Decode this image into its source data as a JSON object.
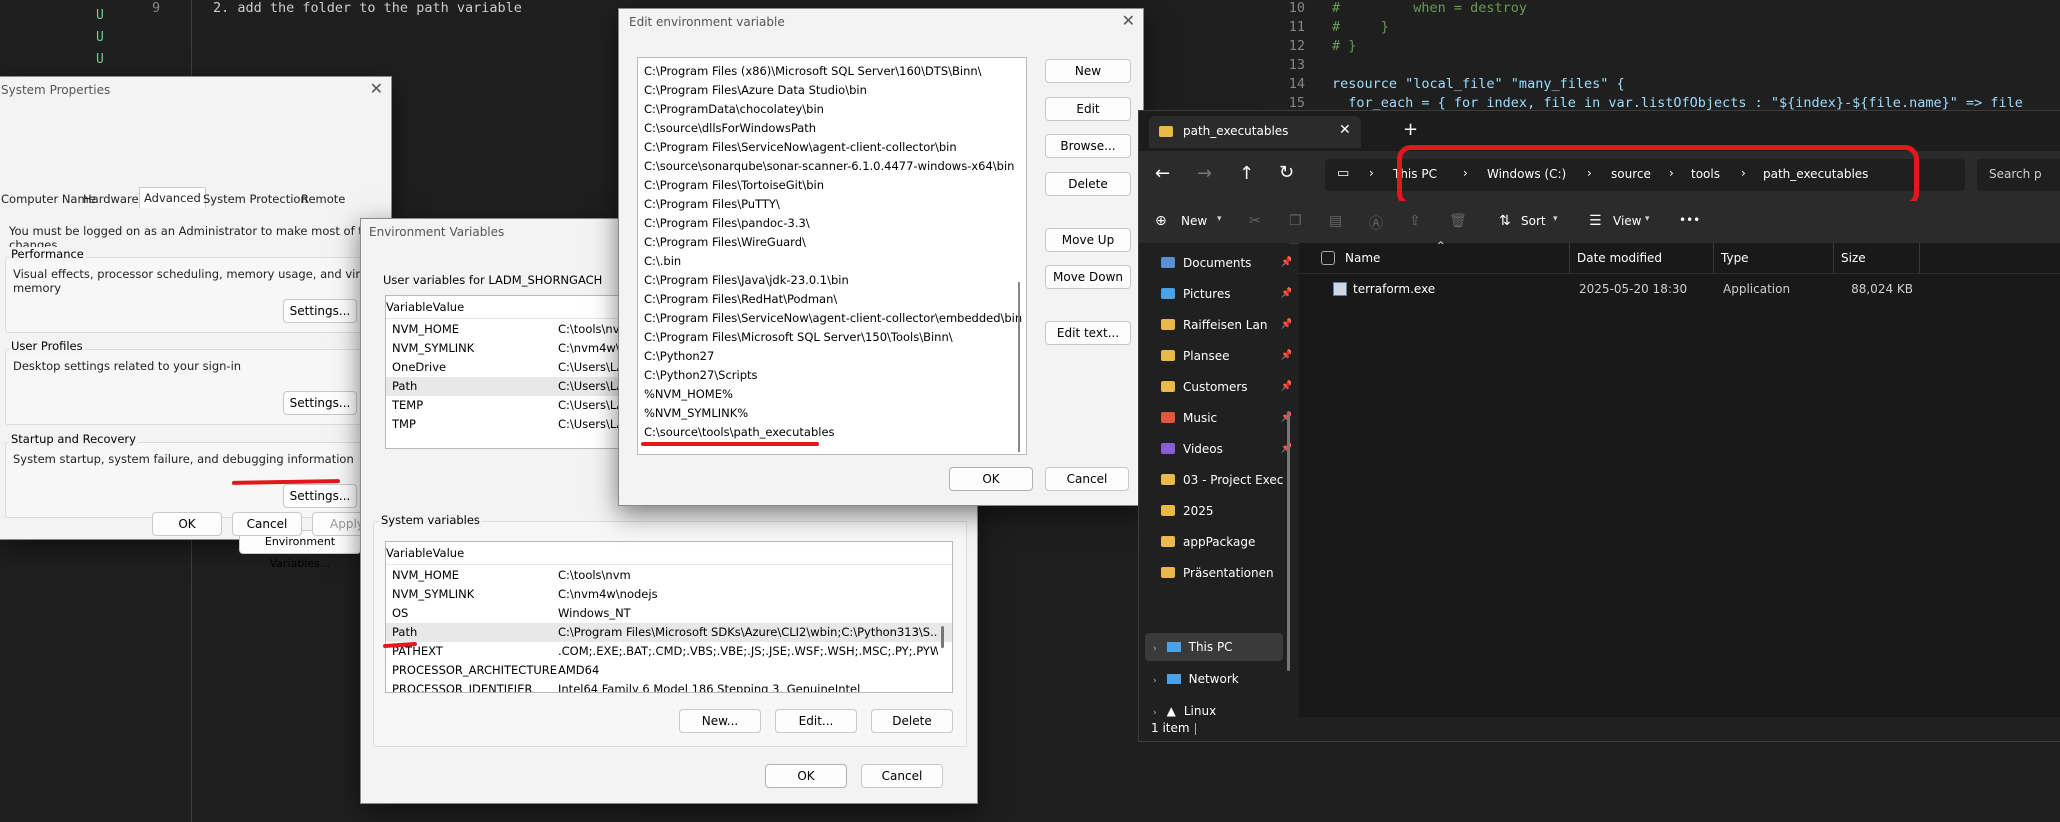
{
  "editor_left": {
    "git_markers": [
      "U",
      "U",
      "U"
    ],
    "line_number": "9",
    "line_text": "2. add the folder to the path variable"
  },
  "editor_right": {
    "lines": [
      {
        "n": "10",
        "text": "#         when = destroy"
      },
      {
        "n": "11",
        "text": "#     }"
      },
      {
        "n": "12",
        "text": "# }"
      },
      {
        "n": "13",
        "text": ""
      },
      {
        "n": "14",
        "text": "resource \"local_file\" \"many_files\" {"
      },
      {
        "n": "15",
        "text": "  for_each = { for index, file in var.listOfObjects : \"${index}-${file.name}\" => file"
      }
    ]
  },
  "system_properties": {
    "title": "System Properties",
    "tabs": [
      "Computer Name",
      "Hardware",
      "Advanced",
      "System Protection",
      "Remote"
    ],
    "admin_note": "You must be logged on as an Administrator to make most of these changes.",
    "performance": {
      "label": "Performance",
      "desc": "Visual effects, processor scheduling, memory usage, and virtual memory",
      "button": "Settings..."
    },
    "user_profiles": {
      "label": "User Profiles",
      "desc": "Desktop settings related to your sign-in",
      "button": "Settings..."
    },
    "startup": {
      "label": "Startup and Recovery",
      "desc": "System startup, system failure, and debugging information",
      "button": "Settings..."
    },
    "env_button": "Environment Variables...",
    "ok": "OK",
    "cancel": "Cancel",
    "apply": "Apply"
  },
  "env_vars": {
    "title": "Environment Variables",
    "user_label": "User variables for LADM_SHORNGACH",
    "col_variable": "Variable",
    "col_value": "Value",
    "user_rows": [
      {
        "name": "NVM_HOME",
        "value": "C:\\tools\\nvm"
      },
      {
        "name": "NVM_SYMLINK",
        "value": "C:\\nvm4w\\nodejs"
      },
      {
        "name": "OneDrive",
        "value": "C:\\Users\\LADM_SHORNGACH\\OneDrive"
      },
      {
        "name": "Path",
        "value": "C:\\Users\\LADM_SHORNGACH\\AppData"
      },
      {
        "name": "TEMP",
        "value": "C:\\Users\\LADM_SHORNGACH\\AppData"
      },
      {
        "name": "TMP",
        "value": "C:\\Users\\LADM_SHORNGACH\\AppData"
      }
    ],
    "system_label": "System variables",
    "system_rows": [
      {
        "name": "NVM_HOME",
        "value": "C:\\tools\\nvm"
      },
      {
        "name": "NVM_SYMLINK",
        "value": "C:\\nvm4w\\nodejs"
      },
      {
        "name": "OS",
        "value": "Windows_NT"
      },
      {
        "name": "Path",
        "value": "C:\\Program Files\\Microsoft SDKs\\Azure\\CLI2\\wbin;C:\\Python313\\S..."
      },
      {
        "name": "PATHEXT",
        "value": ".COM;.EXE;.BAT;.CMD;.VBS;.VBE;.JS;.JSE;.WSF;.WSH;.MSC;.PY;.PYW"
      },
      {
        "name": "PROCESSOR_ARCHITECTURE",
        "value": "AMD64"
      },
      {
        "name": "PROCESSOR_IDENTIFIER",
        "value": "Intel64 Family 6 Model 186 Stepping 3, GenuineIntel"
      }
    ],
    "new": "New...",
    "edit": "Edit...",
    "delete": "Delete",
    "ok": "OK",
    "cancel": "Cancel"
  },
  "edit_env": {
    "title": "Edit environment variable",
    "entries": [
      "C:\\Program Files (x86)\\Microsoft SQL Server\\160\\DTS\\Binn\\",
      "C:\\Program Files\\Azure Data Studio\\bin",
      "C:\\ProgramData\\chocolatey\\bin",
      "C:\\source\\dllsForWindowsPath",
      "C:\\Program Files\\ServiceNow\\agent-client-collector\\bin",
      "C:\\source\\sonarqube\\sonar-scanner-6.1.0.4477-windows-x64\\bin",
      "C:\\Program Files\\TortoiseGit\\bin",
      "C:\\Program Files\\PuTTY\\",
      "C:\\Program Files\\pandoc-3.3\\",
      "C:\\Program Files\\WireGuard\\",
      "C:\\.bin",
      "C:\\Program Files\\Java\\jdk-23.0.1\\bin",
      "C:\\Program Files\\RedHat\\Podman\\",
      "C:\\Program Files\\ServiceNow\\agent-client-collector\\embedded\\bin",
      "C:\\Program Files\\Microsoft SQL Server\\150\\Tools\\Binn\\",
      "C:\\Python27",
      "C:\\Python27\\Scripts",
      "%NVM_HOME%",
      "%NVM_SYMLINK%",
      "C:\\source\\tools\\path_executables"
    ],
    "buttons": {
      "new": "New",
      "edit": "Edit",
      "browse": "Browse...",
      "delete": "Delete",
      "move_up": "Move Up",
      "move_down": "Move Down",
      "edit_text": "Edit text..."
    },
    "ok": "OK",
    "cancel": "Cancel"
  },
  "explorer": {
    "tab_title": "path_executables",
    "breadcrumb": [
      "This PC",
      "Windows (C:)",
      "source",
      "tools",
      "path_executables"
    ],
    "search_placeholder": "Search p",
    "toolbar": {
      "new": "New",
      "sort": "Sort",
      "view": "View",
      "more": "•••"
    },
    "sidebar": [
      {
        "label": "Documents",
        "icon": "documents-icon",
        "pinned": true
      },
      {
        "label": "Pictures",
        "icon": "pictures-icon",
        "pinned": true
      },
      {
        "label": "Raiffeisen Lan",
        "icon": "folder-icon",
        "pinned": true
      },
      {
        "label": "Plansee",
        "icon": "folder-icon",
        "pinned": true
      },
      {
        "label": "Customers",
        "icon": "folder-icon",
        "pinned": true
      },
      {
        "label": "Music",
        "icon": "music-icon",
        "pinned": true
      },
      {
        "label": "Videos",
        "icon": "videos-icon",
        "pinned": true
      },
      {
        "label": "03 - Project Exec",
        "icon": "folder-icon",
        "pinned": false
      },
      {
        "label": "2025",
        "icon": "folder-icon",
        "pinned": false
      },
      {
        "label": "appPackage",
        "icon": "folder-icon",
        "pinned": false
      },
      {
        "label": "Präsentationen",
        "icon": "folder-icon",
        "pinned": false
      }
    ],
    "tree": [
      {
        "label": "This PC"
      },
      {
        "label": "Network"
      },
      {
        "label": "Linux"
      }
    ],
    "columns": {
      "name": "Name",
      "date": "Date modified",
      "type": "Type",
      "size": "Size"
    },
    "files": [
      {
        "name": "terraform.exe",
        "date": "2025-05-20 18:30",
        "type": "Application",
        "size": "88,024 KB"
      }
    ],
    "status": "1 item"
  },
  "colors": {
    "annotation_red": "#e3171e",
    "explorer_bg": "#202020",
    "editor_bg": "#1f1f1f"
  }
}
